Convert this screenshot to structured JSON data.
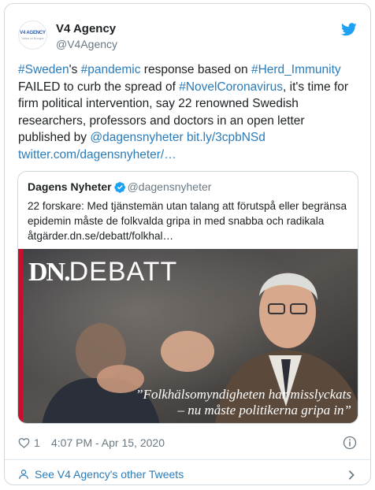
{
  "account": {
    "display_name": "V4 Agency",
    "handle": "@V4Agency",
    "avatar_text": "V4 AGENCY",
    "avatar_subtext": "Voice of Europe"
  },
  "tweet": {
    "segments": [
      {
        "text": "#Sweden",
        "link": true
      },
      {
        "text": "'s ",
        "link": false
      },
      {
        "text": "#pandemic",
        "link": true
      },
      {
        "text": " response based on ",
        "link": false
      },
      {
        "text": "#Herd_Immunity",
        "link": true
      },
      {
        "text": " FAILED to curb the spread of ",
        "link": false
      },
      {
        "text": "#NovelCoronavirus",
        "link": true
      },
      {
        "text": ", it's time for firm political intervention, say 22 renowned Swedish researchers, professors and doctors in an open letter published by ",
        "link": false
      },
      {
        "text": "@dagensnyheter",
        "link": true
      },
      {
        "text": " ",
        "link": false
      },
      {
        "text": "bit.ly/3cpbNSd",
        "link": true
      },
      {
        "text": " ",
        "link": false
      },
      {
        "text": "twitter.com/dagensnyheter/…",
        "link": true
      }
    ]
  },
  "quoted": {
    "name": "Dagens Nyheter",
    "handle": "@dagensnyheter",
    "text": "22 forskare: Med tjänstemän utan talang att förutspå eller begränsa epidemin måste de folkvalda gripa in med snabba och radikala åtgärder.dn.se/debatt/folkhal…",
    "image": {
      "brand_dn": "DN.",
      "brand_debatt": "DEBATT",
      "caption_line1": "”Folkhälsomyndigheten har misslyckats",
      "caption_line2": "– nu måste politikerna gripa in”"
    }
  },
  "meta": {
    "like_count": "1",
    "timestamp": "4:07 PM - Apr 15, 2020"
  },
  "footer": {
    "label": "See V4 Agency's other Tweets"
  },
  "colors": {
    "link": "#2b7bb9",
    "twitter_blue": "#1da1f2",
    "muted": "#697882",
    "border": "#cfd9de"
  },
  "icons": [
    "twitter-bird-icon",
    "verified-badge-icon",
    "heart-icon",
    "info-icon",
    "person-icon",
    "chevron-right-icon"
  ]
}
